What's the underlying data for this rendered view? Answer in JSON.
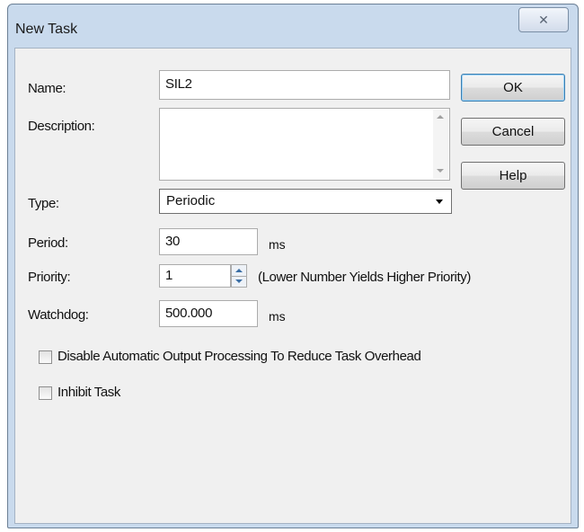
{
  "window": {
    "title": "New Task",
    "close_glyph": "✕"
  },
  "buttons": {
    "ok": "OK",
    "cancel": "Cancel",
    "help": "Help"
  },
  "fields": {
    "name_label": "Name:",
    "name_value": "SIL2",
    "description_label": "Description:",
    "description_value": "",
    "type_label": "Type:",
    "type_value": "Periodic",
    "period_label": "Period:",
    "period_value": "30",
    "period_unit": "ms",
    "priority_label": "Priority:",
    "priority_value": "1",
    "priority_hint": "(Lower Number Yields Higher Priority)",
    "watchdog_label": "Watchdog:",
    "watchdog_value": "500.000",
    "watchdog_unit": "ms"
  },
  "options": {
    "disable_output_label": "Disable Automatic Output Processing To Reduce Task Overhead",
    "disable_output_checked": false,
    "inhibit_label": "Inhibit Task",
    "inhibit_checked": false
  },
  "icons": {
    "close": "close-icon",
    "dropdown": "chevron-down-icon",
    "scroll_up": "scroll-up-icon",
    "scroll_down": "scroll-down-icon",
    "spin_up": "spin-up-icon",
    "spin_down": "spin-down-icon"
  },
  "colors": {
    "frame": "#c9daed",
    "client": "#f0f0f0",
    "default_button_border": "#3c7fb1"
  }
}
